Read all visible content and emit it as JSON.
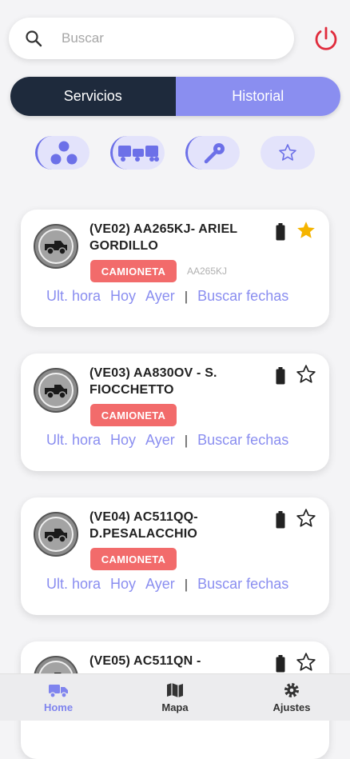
{
  "search": {
    "placeholder": "Buscar"
  },
  "tabs": [
    {
      "label": "Servicios",
      "active": true
    },
    {
      "label": "Historial",
      "active": false
    }
  ],
  "filters": [
    {
      "icon": "group-icon"
    },
    {
      "icon": "vehicles-icon"
    },
    {
      "icon": "key-icon"
    },
    {
      "icon": "star-outline-icon"
    }
  ],
  "vehicles": [
    {
      "line1": "(VE02) AA265KJ- ARIEL",
      "line2": "GORDILLO",
      "type": "CAMIONETA",
      "plate": "AA265KJ",
      "favorite": true
    },
    {
      "line1": "(VE03) AA830OV - S.",
      "line2": "FIOCCHETTO",
      "type": "CAMIONETA",
      "plate": "",
      "favorite": false
    },
    {
      "line1": "(VE04) AC511QQ-",
      "line2": "D.PESALACCHIO",
      "type": "CAMIONETA",
      "plate": "",
      "favorite": false
    },
    {
      "line1": "(VE05) AC511QN -",
      "line2": "",
      "type": "",
      "plate": "",
      "favorite": false
    }
  ],
  "actions": {
    "last_hour": "Ult. hora",
    "today": "Hoy",
    "yesterday": "Ayer",
    "separator": "|",
    "search_dates": "Buscar fechas"
  },
  "nav": [
    {
      "label": "Home",
      "icon": "truck-icon",
      "active": true
    },
    {
      "label": "Mapa",
      "icon": "map-icon",
      "active": false
    },
    {
      "label": "Ajustes",
      "icon": "gear-icon",
      "active": false
    }
  ],
  "colors": {
    "accent": "#8a8ef0",
    "dark": "#1e2a3c",
    "tag": "#f26b6b",
    "power": "#e02b3c",
    "star": "#f5b400"
  }
}
